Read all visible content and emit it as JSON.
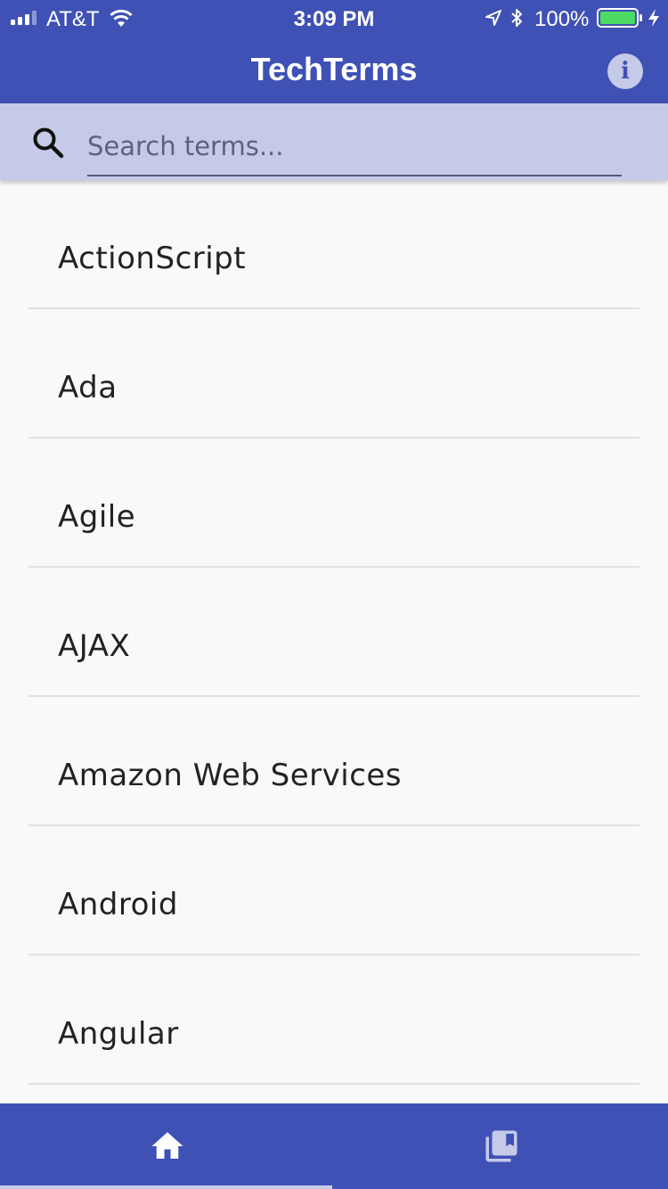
{
  "status_bar": {
    "carrier": "AT&T",
    "time": "3:09 PM",
    "battery": "100%"
  },
  "app_bar": {
    "title": "TechTerms",
    "info_icon": "i"
  },
  "search": {
    "placeholder": "Search terms...",
    "value": ""
  },
  "terms": [
    "ActionScript",
    "Ada",
    "Agile",
    "AJAX",
    "Amazon Web Services",
    "Android",
    "Angular"
  ],
  "bottom_nav": {
    "tabs": [
      {
        "name": "home",
        "icon": "home-icon",
        "active": true
      },
      {
        "name": "saved",
        "icon": "bookmarks-icon",
        "active": false
      }
    ]
  },
  "colors": {
    "primary": "#3f51b5",
    "accent_light": "#c5cae9",
    "background": "#f9f9f9",
    "battery": "#4cd964"
  }
}
